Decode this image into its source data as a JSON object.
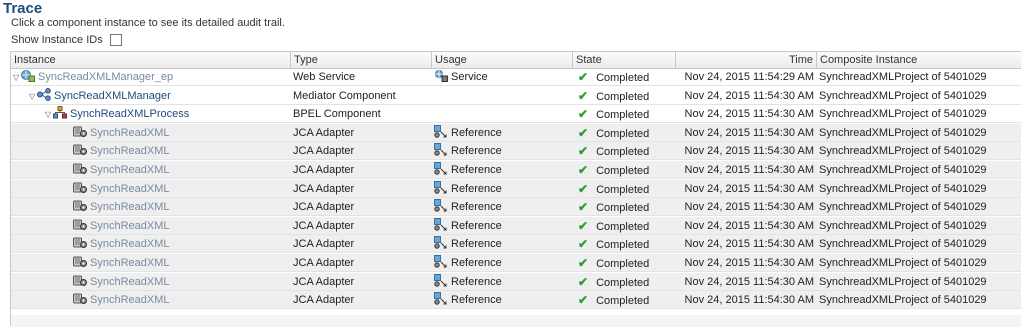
{
  "page": {
    "title": "Trace",
    "subtitle": "Click a component instance to see its detailed audit trail.",
    "show_ids_label": "Show Instance IDs"
  },
  "columns": {
    "instance": "Instance",
    "type": "Type",
    "usage": "Usage",
    "state": "State",
    "time": "Time",
    "composite": "Composite Instance"
  },
  "colors": {
    "link": "#7a8aa0",
    "link_active": "#1f4c7c",
    "title": "#1f4c7c",
    "check": "#2e9e2e"
  },
  "rows": [
    {
      "tri": "▽",
      "icon": "web-service-icon",
      "instance": "SyncReadXMLManager_ep",
      "type": "Web Service",
      "usage_icon": "service-icon",
      "usage": "Service",
      "state": "Completed",
      "time": "Nov 24, 2015 11:54:29 AM",
      "composite": "SynchreadXMLProject of 5401029"
    },
    {
      "tri": "▽",
      "icon": "mediator-icon",
      "instance": "SyncReadXMLManager",
      "type": "Mediator Component",
      "usage_icon": "",
      "usage": "",
      "state": "Completed",
      "time": "Nov 24, 2015 11:54:30 AM",
      "composite": "SynchreadXMLProject of 5401029"
    },
    {
      "tri": "▽",
      "icon": "bpel-icon",
      "instance": "SynchReadXMLProcess",
      "type": "BPEL Component",
      "usage_icon": "",
      "usage": "",
      "state": "Completed",
      "time": "Nov 24, 2015 11:54:30 AM",
      "composite": "SynchreadXMLProject of 5401029"
    },
    {
      "tri": "",
      "icon": "adapter-icon",
      "instance": "SynchReadXML",
      "type": "JCA Adapter",
      "usage_icon": "reference-icon",
      "usage": "Reference",
      "state": "Completed",
      "time": "Nov 24, 2015 11:54:30 AM",
      "composite": "SynchreadXMLProject of 5401029"
    },
    {
      "tri": "",
      "icon": "adapter-icon",
      "instance": "SynchReadXML",
      "type": "JCA Adapter",
      "usage_icon": "reference-icon",
      "usage": "Reference",
      "state": "Completed",
      "time": "Nov 24, 2015 11:54:30 AM",
      "composite": "SynchreadXMLProject of 5401029"
    },
    {
      "tri": "",
      "icon": "adapter-icon",
      "instance": "SynchReadXML",
      "type": "JCA Adapter",
      "usage_icon": "reference-icon",
      "usage": "Reference",
      "state": "Completed",
      "time": "Nov 24, 2015 11:54:30 AM",
      "composite": "SynchreadXMLProject of 5401029"
    },
    {
      "tri": "",
      "icon": "adapter-icon",
      "instance": "SynchReadXML",
      "type": "JCA Adapter",
      "usage_icon": "reference-icon",
      "usage": "Reference",
      "state": "Completed",
      "time": "Nov 24, 2015 11:54:30 AM",
      "composite": "SynchreadXMLProject of 5401029"
    },
    {
      "tri": "",
      "icon": "adapter-icon",
      "instance": "SynchReadXML",
      "type": "JCA Adapter",
      "usage_icon": "reference-icon",
      "usage": "Reference",
      "state": "Completed",
      "time": "Nov 24, 2015 11:54:30 AM",
      "composite": "SynchreadXMLProject of 5401029"
    },
    {
      "tri": "",
      "icon": "adapter-icon",
      "instance": "SynchReadXML",
      "type": "JCA Adapter",
      "usage_icon": "reference-icon",
      "usage": "Reference",
      "state": "Completed",
      "time": "Nov 24, 2015 11:54:30 AM",
      "composite": "SynchreadXMLProject of 5401029"
    },
    {
      "tri": "",
      "icon": "adapter-icon",
      "instance": "SynchReadXML",
      "type": "JCA Adapter",
      "usage_icon": "reference-icon",
      "usage": "Reference",
      "state": "Completed",
      "time": "Nov 24, 2015 11:54:30 AM",
      "composite": "SynchreadXMLProject of 5401029"
    },
    {
      "tri": "",
      "icon": "adapter-icon",
      "instance": "SynchReadXML",
      "type": "JCA Adapter",
      "usage_icon": "reference-icon",
      "usage": "Reference",
      "state": "Completed",
      "time": "Nov 24, 2015 11:54:30 AM",
      "composite": "SynchreadXMLProject of 5401029"
    },
    {
      "tri": "",
      "icon": "adapter-icon",
      "instance": "SynchReadXML",
      "type": "JCA Adapter",
      "usage_icon": "reference-icon",
      "usage": "Reference",
      "state": "Completed",
      "time": "Nov 24, 2015 11:54:30 AM",
      "composite": "SynchreadXMLProject of 5401029"
    },
    {
      "tri": "",
      "icon": "adapter-icon",
      "instance": "SynchReadXML",
      "type": "JCA Adapter",
      "usage_icon": "reference-icon",
      "usage": "Reference",
      "state": "Completed",
      "time": "Nov 24, 2015 11:54:30 AM",
      "composite": "SynchreadXMLProject of 5401029"
    }
  ]
}
